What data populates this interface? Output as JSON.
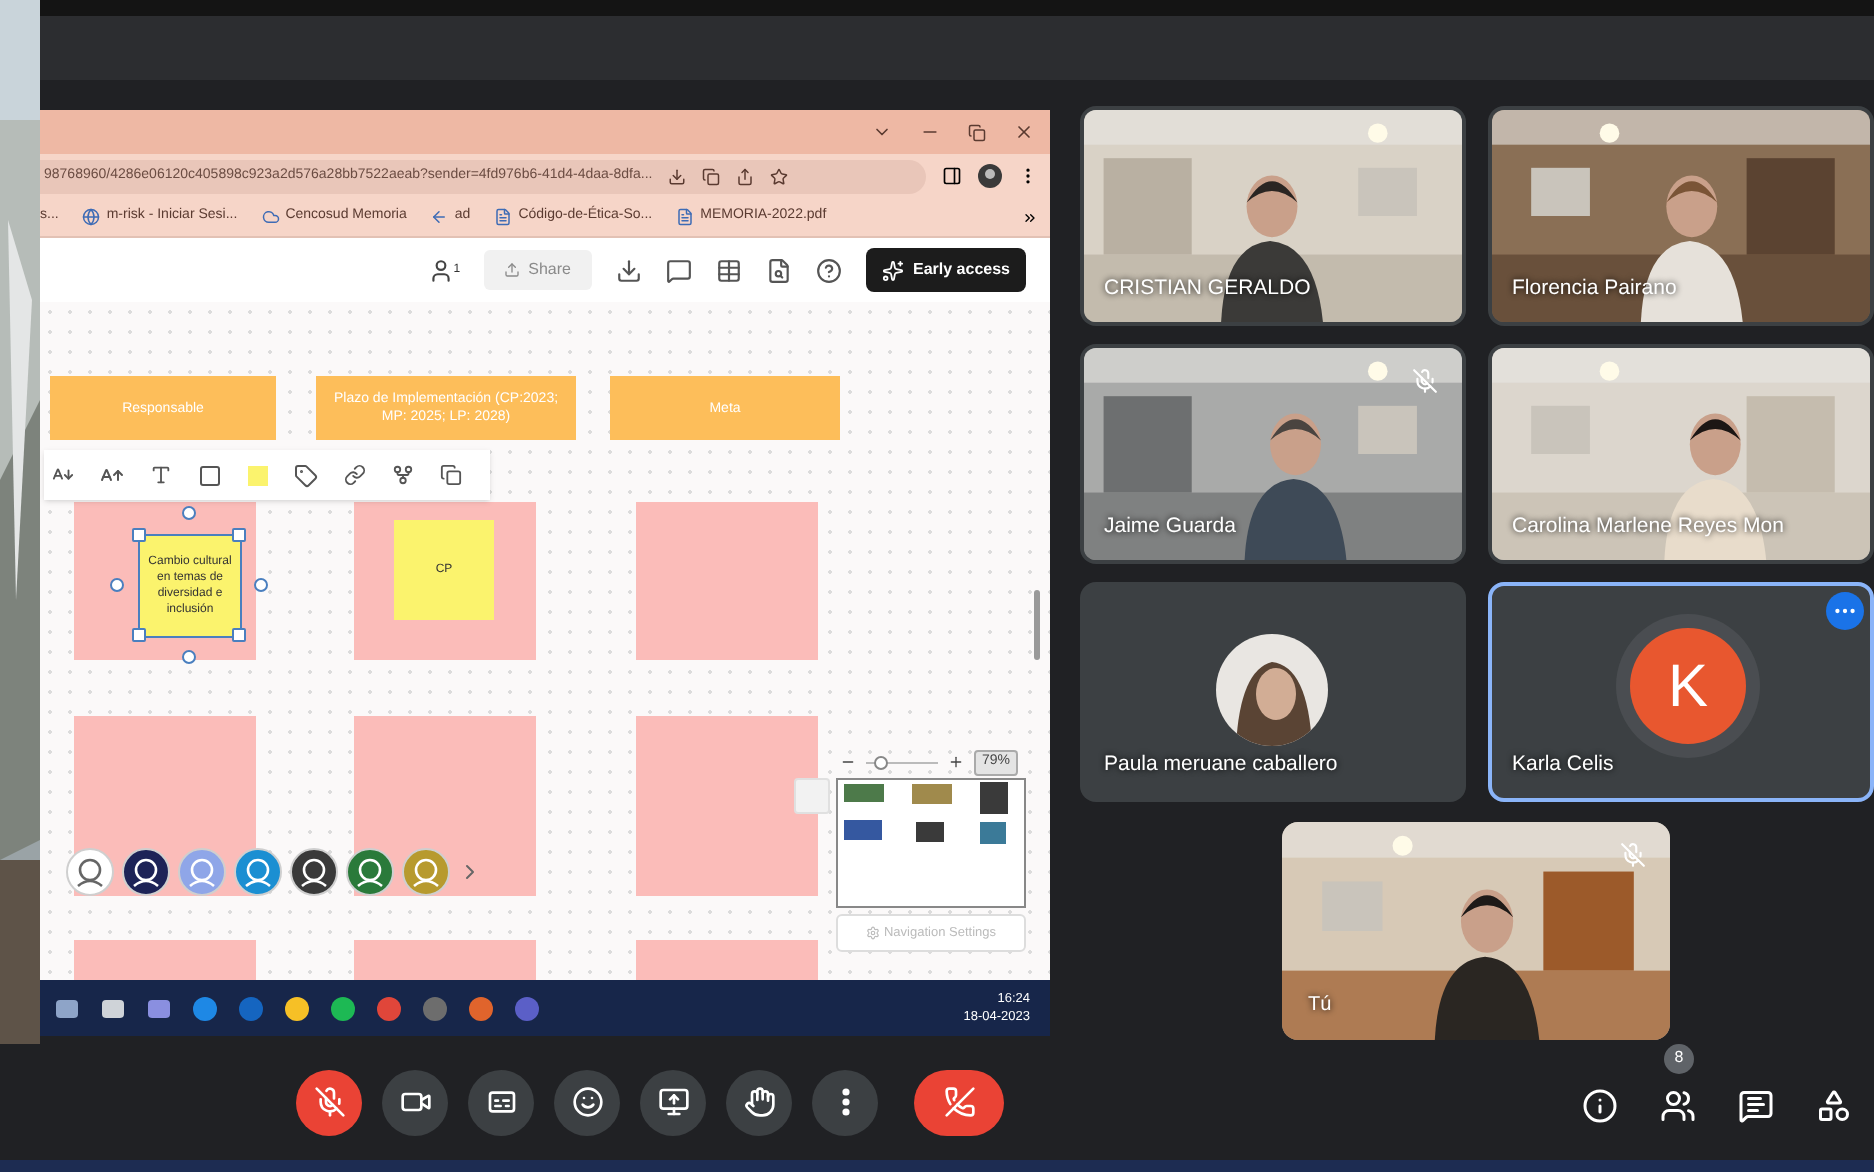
{
  "browser": {
    "url": "98768960/4286e06120c405898c923a2d576a28bb7522aeab?sender=4fd976b6-41d4-4daa-8dfa...",
    "bookmarks": [
      {
        "label": "s..."
      },
      {
        "label": "m-risk - Iniciar Sesi..."
      },
      {
        "label": "Cencosud Memoria"
      },
      {
        "label": "ad"
      },
      {
        "label": "Código-de-Ética-So..."
      },
      {
        "label": "MEMORIA-2022.pdf"
      }
    ]
  },
  "whiteboard": {
    "collaborators": "1",
    "share_button": {
      "label": "Share",
      "disabled": true
    },
    "early_access": "Early access",
    "headers": [
      {
        "text": "Responsable"
      },
      {
        "text": "Plazo de Implementación (CP:2023; MP: 2025; LP: 2028)"
      },
      {
        "text": "Meta"
      }
    ],
    "notes": [
      {
        "text": "Cambio cultural en temas de diversidad e inclusión",
        "selected": true
      },
      {
        "text": "CP",
        "selected": false
      }
    ],
    "zoom_slider": {
      "level": 0.15
    },
    "zoom": "79%",
    "navigation_settings": "Navigation Settings"
  },
  "taskbar": {
    "time": "16:24",
    "date": "18-04-2023"
  },
  "tile_rows": [
    {
      "tiles": [
        {
          "name": "CRISTIAN GERALDO",
          "kind": "video",
          "muted": false,
          "highlighted": false
        },
        {
          "name": "Florencia Pairano",
          "kind": "video",
          "muted": false,
          "highlighted": false
        }
      ]
    },
    {
      "tiles": [
        {
          "name": "Jaime Guarda",
          "kind": "video",
          "muted": true,
          "highlighted": false
        },
        {
          "name": "Carolina Marlene Reyes Mon",
          "kind": "video",
          "muted": false,
          "highlighted": false
        }
      ]
    },
    {
      "tiles": [
        {
          "name": "Paula meruane caballero",
          "kind": "photo_avatar",
          "muted": false,
          "highlighted": false
        },
        {
          "name": "Karla Celis",
          "kind": "letter_avatar",
          "initial": "K",
          "color": "#e8572f",
          "muted": false,
          "highlighted": true
        }
      ]
    }
  ],
  "self_tile": {
    "name": "Tú",
    "muted": true
  },
  "call_controls": [
    {
      "kind": "mic",
      "on": false
    },
    {
      "kind": "camera",
      "on": true
    },
    {
      "kind": "captions"
    },
    {
      "kind": "reactions"
    },
    {
      "kind": "present"
    },
    {
      "kind": "raise_hand"
    },
    {
      "kind": "more"
    },
    {
      "kind": "leave"
    }
  ],
  "side_controls": [
    {
      "kind": "info"
    },
    {
      "kind": "people",
      "badge": "8"
    },
    {
      "kind": "chat"
    },
    {
      "kind": "activities"
    }
  ]
}
